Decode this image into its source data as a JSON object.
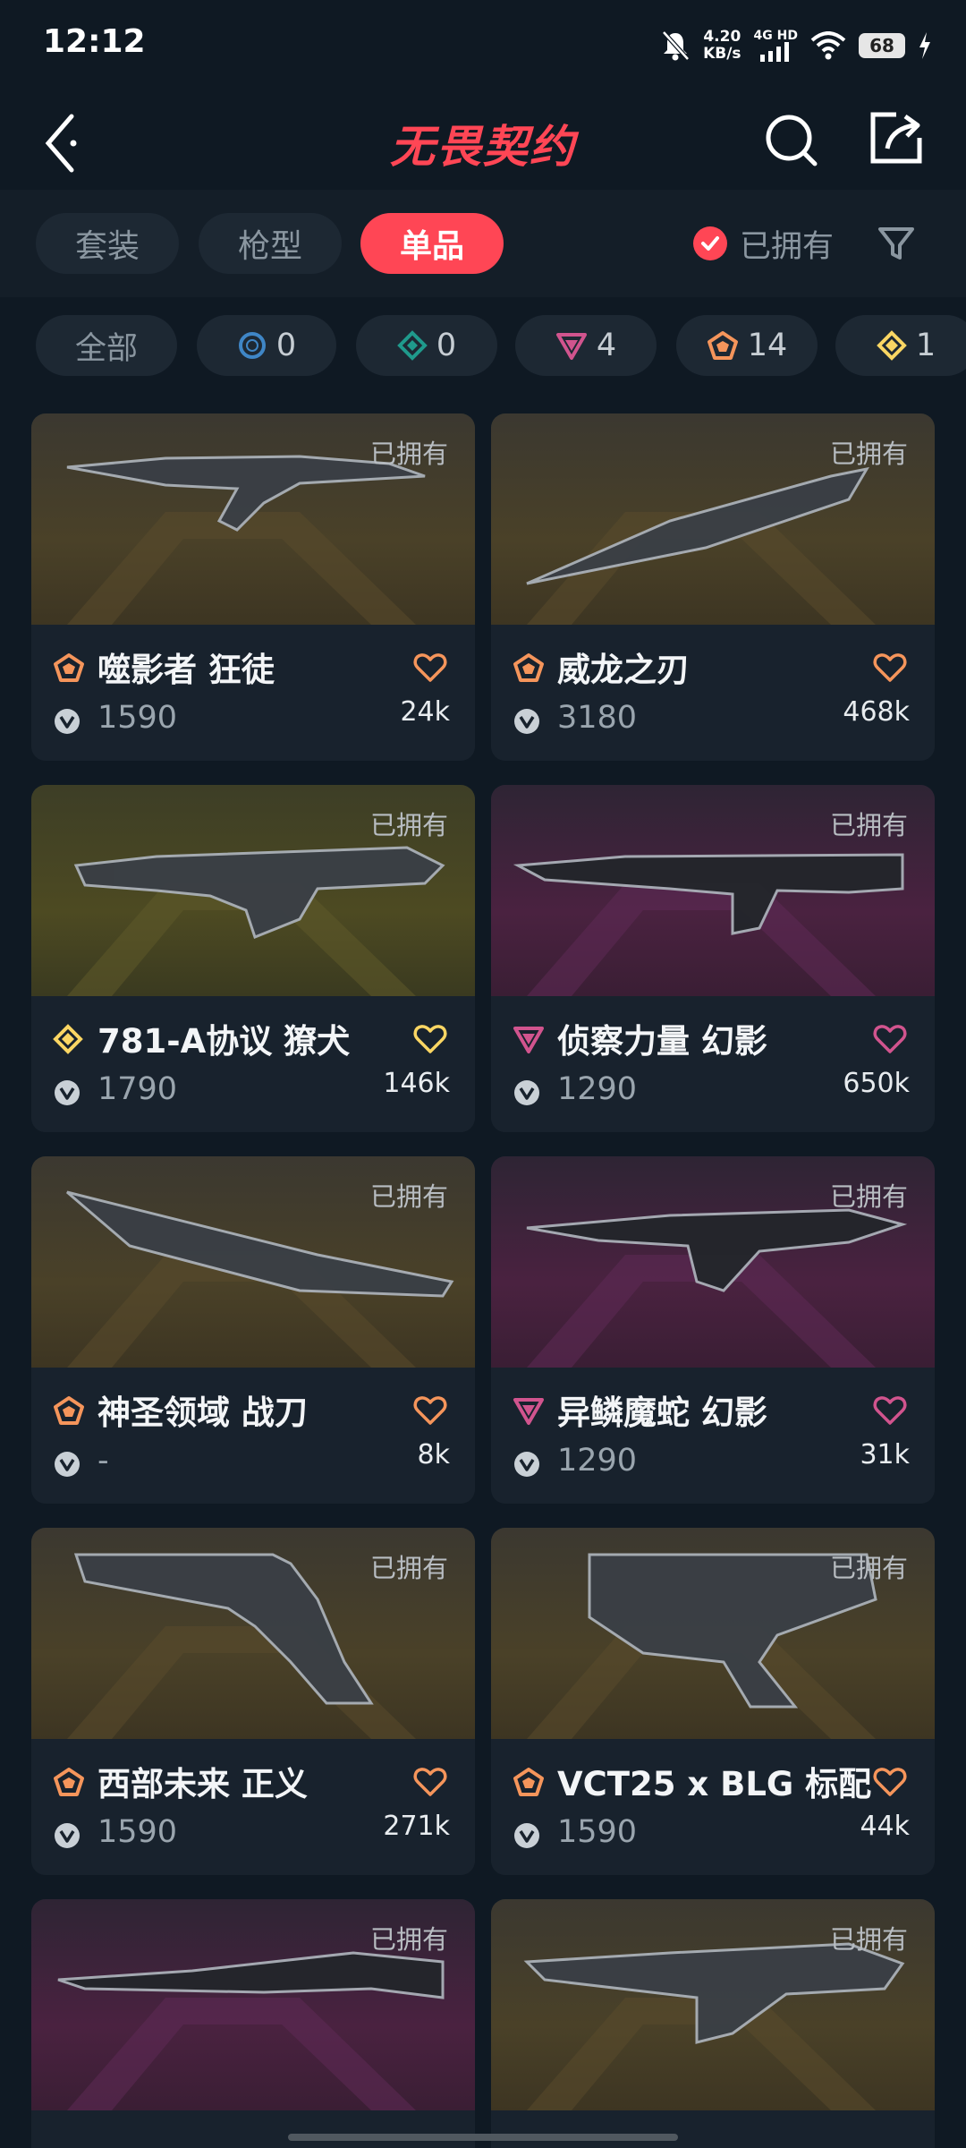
{
  "status_bar": {
    "time": "12:12",
    "net_speed_value": "4.20",
    "net_speed_unit": "KB/s",
    "signal_label": "4G HD",
    "battery": "68"
  },
  "header": {
    "title": "无畏契约",
    "title_color": "#ff4655"
  },
  "tabs": [
    {
      "label": "套装",
      "active": false
    },
    {
      "label": "枪型",
      "active": false
    },
    {
      "label": "单品",
      "active": true
    }
  ],
  "owned_filter": {
    "label": "已拥有",
    "checked": true
  },
  "rarity_chips": [
    {
      "label": "全部"
    },
    {
      "icon": "select-tier-icon",
      "color": "#3f86c6",
      "count": "0"
    },
    {
      "icon": "deluxe-tier-icon",
      "color": "#1f9a8c",
      "count": "0"
    },
    {
      "icon": "premium-tier-icon",
      "color": "#d1548e",
      "count": "4"
    },
    {
      "icon": "exclusive-tier-icon",
      "color": "#f5955b",
      "count": "14"
    },
    {
      "icon": "ultra-tier-icon",
      "color": "#fad663",
      "count": "1"
    }
  ],
  "cards": [
    {
      "owned": "已拥有",
      "name": "噬影者 狂徒",
      "tier_color": "#f5955b",
      "price": "1590",
      "likes": "24k",
      "bg": "gold"
    },
    {
      "owned": "已拥有",
      "name": "威龙之刃",
      "tier_color": "#f5955b",
      "price": "3180",
      "likes": "468k",
      "bg": "gold"
    },
    {
      "owned": "已拥有",
      "name": "781-A协议 獠犬",
      "tier_color": "#fad663",
      "price": "1790",
      "likes": "146k",
      "bg": "olive"
    },
    {
      "owned": "已拥有",
      "name": "侦察力量 幻影",
      "tier_color": "#d1548e",
      "price": "1290",
      "likes": "650k",
      "bg": "purple"
    },
    {
      "owned": "已拥有",
      "name": "神圣领域 战刀",
      "tier_color": "#f5955b",
      "price": "-",
      "likes": "8k",
      "bg": "gold"
    },
    {
      "owned": "已拥有",
      "name": "异鳞魔蛇 幻影",
      "tier_color": "#d1548e",
      "price": "1290",
      "likes": "31k",
      "bg": "purple"
    },
    {
      "owned": "已拥有",
      "name": "西部未来 正义",
      "tier_color": "#f5955b",
      "price": "1590",
      "likes": "271k",
      "bg": "gold"
    },
    {
      "owned": "已拥有",
      "name": "VCT25 x BLG 标配",
      "tier_color": "#f5955b",
      "price": "1590",
      "likes": "44k",
      "bg": "gold"
    },
    {
      "owned": "已拥有",
      "bg": "purple"
    },
    {
      "owned": "已拥有",
      "bg": "gold"
    }
  ]
}
